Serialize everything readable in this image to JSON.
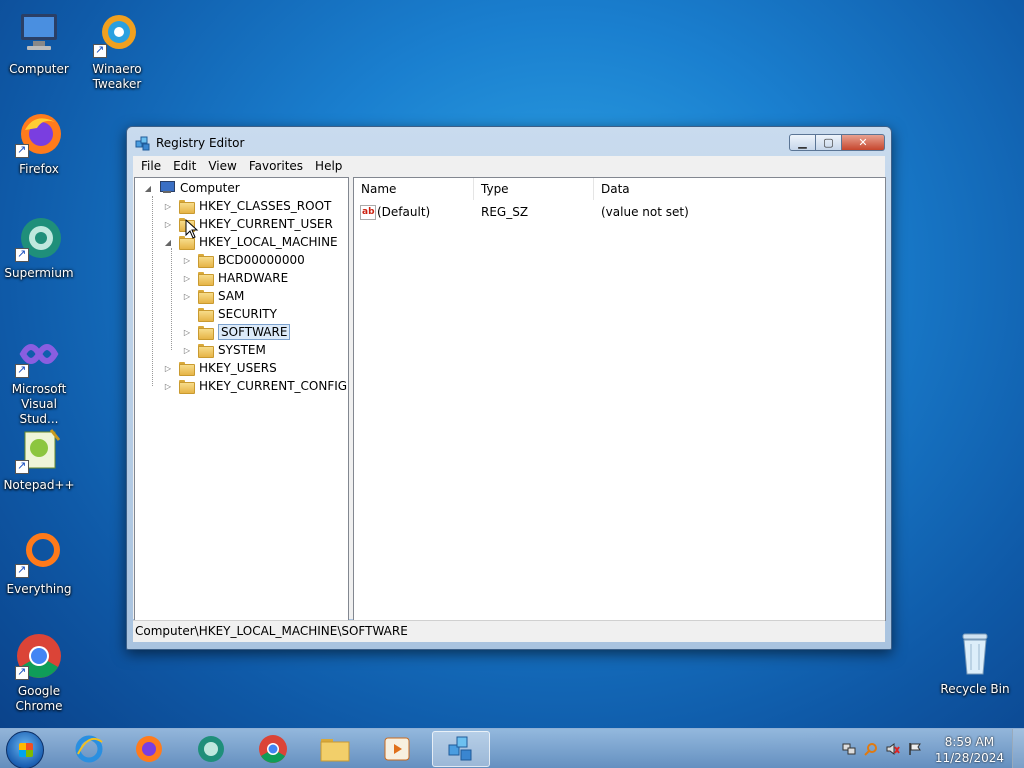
{
  "desktop": {
    "icons": [
      {
        "label": "Computer"
      },
      {
        "label": "Winaero Tweaker"
      },
      {
        "label": "Firefox"
      },
      {
        "label": "Supermium"
      },
      {
        "label": "Microsoft Visual Stud..."
      },
      {
        "label": "Notepad++"
      },
      {
        "label": "Everything"
      },
      {
        "label": "Google Chrome"
      },
      {
        "label": "Recycle Bin"
      }
    ]
  },
  "window": {
    "title": "Registry Editor",
    "menu": [
      "File",
      "Edit",
      "View",
      "Favorites",
      "Help"
    ],
    "tree": {
      "root": "Computer",
      "items": [
        "HKEY_CLASSES_ROOT",
        "HKEY_CURRENT_USER",
        "HKEY_LOCAL_MACHINE",
        "BCD00000000",
        "HARDWARE",
        "SAM",
        "SECURITY",
        "SOFTWARE",
        "SYSTEM",
        "HKEY_USERS",
        "HKEY_CURRENT_CONFIG"
      ]
    },
    "list": {
      "columns": [
        "Name",
        "Type",
        "Data"
      ],
      "rows": [
        {
          "name": "(Default)",
          "type": "REG_SZ",
          "data": "(value not set)"
        }
      ]
    },
    "status": "Computer\\HKEY_LOCAL_MACHINE\\SOFTWARE"
  },
  "taskbar": {
    "time": "8:59 AM",
    "date": "11/28/2024"
  },
  "colors": {
    "accent": "#1a7fcf",
    "selection": "#dceaf9"
  }
}
